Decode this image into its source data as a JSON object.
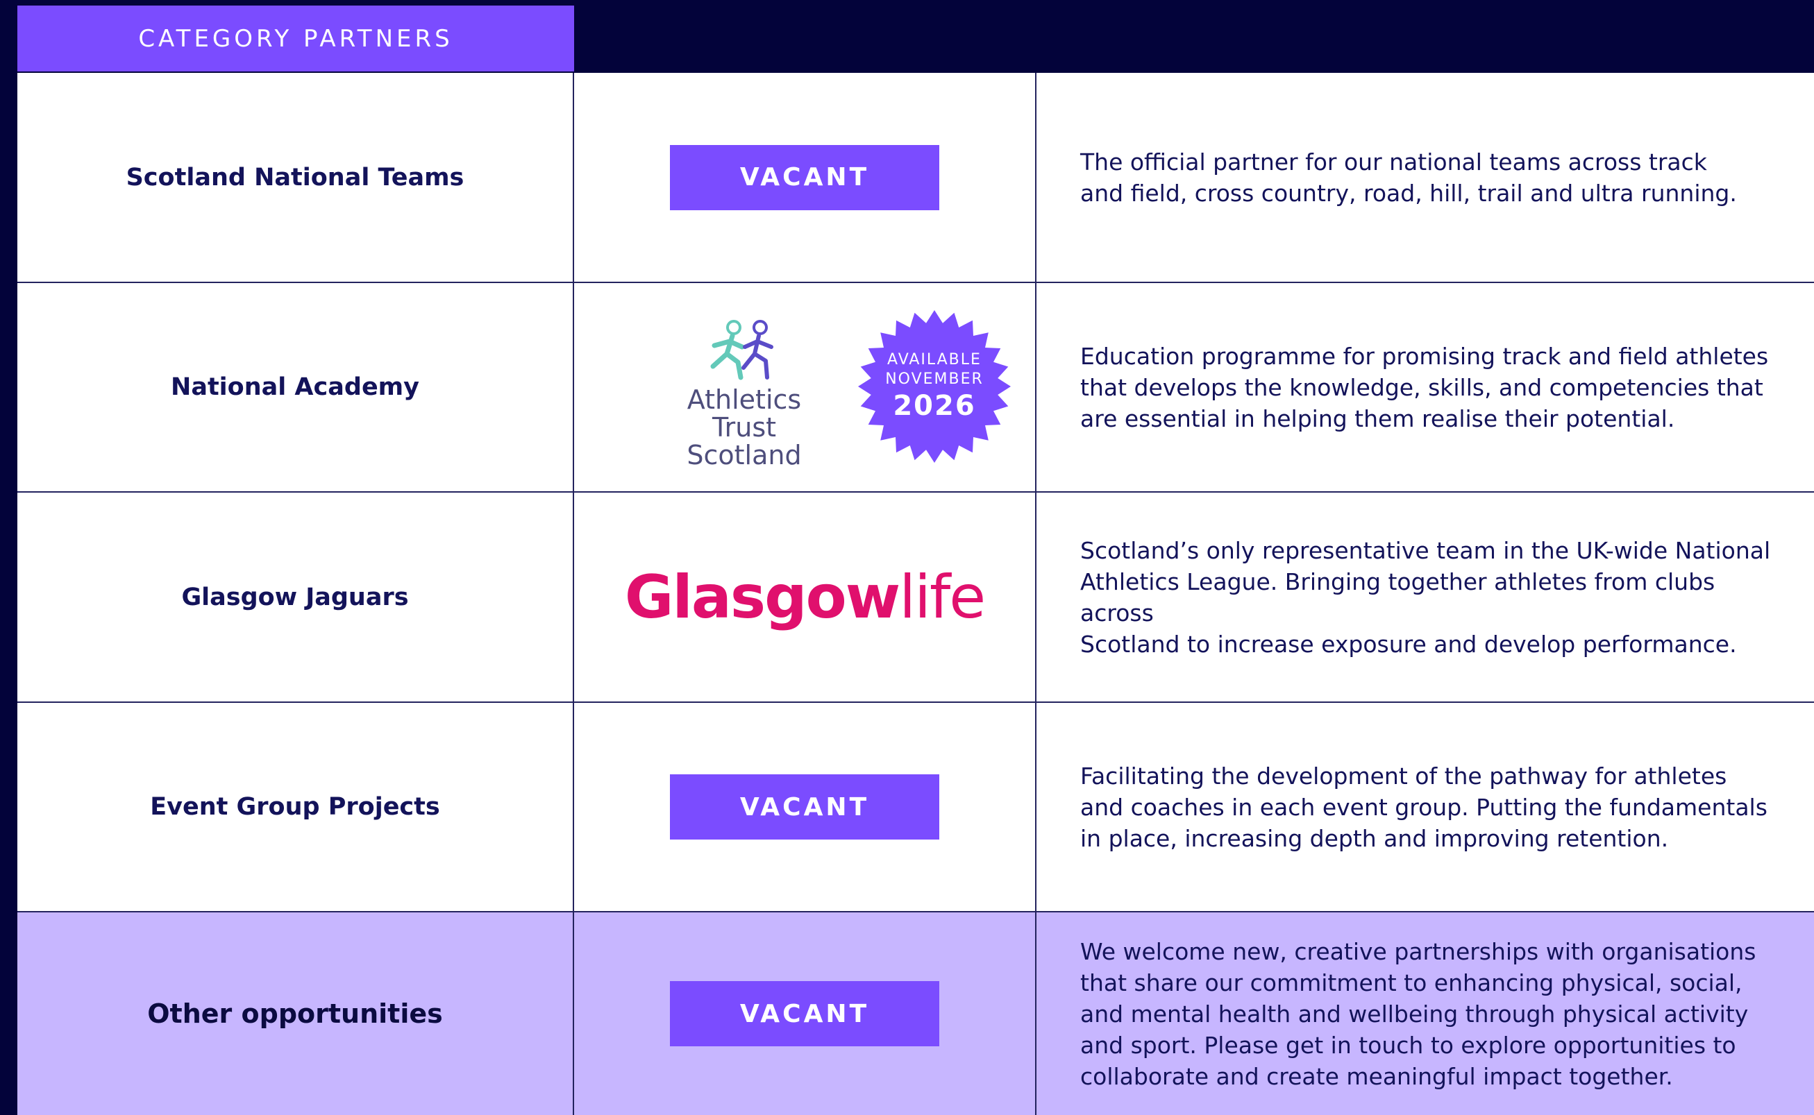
{
  "header": {
    "title": "CATEGORY PARTNERS"
  },
  "colors": {
    "background": "#03033a",
    "accent": "#7b4cff",
    "highlight_row": "#c7b6ff",
    "text": "#13135a",
    "glasgow_pink": "#e0106d"
  },
  "rows": [
    {
      "name": "Scotland National Teams",
      "vacant_label": "VACANT",
      "description": "The official partner for our national teams across track\nand field, cross country, road, hill, trail and ultra running."
    },
    {
      "name": "National Academy",
      "logo": {
        "icon": "runners-icon",
        "line1": "Athletics Trust",
        "line2": "Scotland"
      },
      "badge": {
        "line1": "AVAILABLE",
        "line2": "NOVEMBER",
        "line3": "2026"
      },
      "description": "Education programme for promising track and field athletes\nthat develops the knowledge, skills, and competencies that\nare essential in helping them realise their potential."
    },
    {
      "name": "Glasgow Jaguars",
      "logo": {
        "part1": "Glasgow",
        "part2": "life"
      },
      "description": "Scotland’s only representative team in the UK-wide National\nAthletics League. Bringing together athletes from clubs across\nScotland to increase exposure and develop performance."
    },
    {
      "name": "Event Group Projects",
      "vacant_label": "VACANT",
      "description": "Facilitating the development of the pathway for athletes\nand coaches in each event group. Putting the fundamentals\nin place, increasing depth and improving retention."
    },
    {
      "name": "Other opportunities",
      "vacant_label": "VACANT",
      "description": "We welcome new, creative partnerships with organisations\nthat share our commitment to enhancing physical, social,\nand mental health and wellbeing through physical activity\nand sport. Please get in touch to explore opportunities to\ncollaborate and create meaningful impact together."
    }
  ]
}
